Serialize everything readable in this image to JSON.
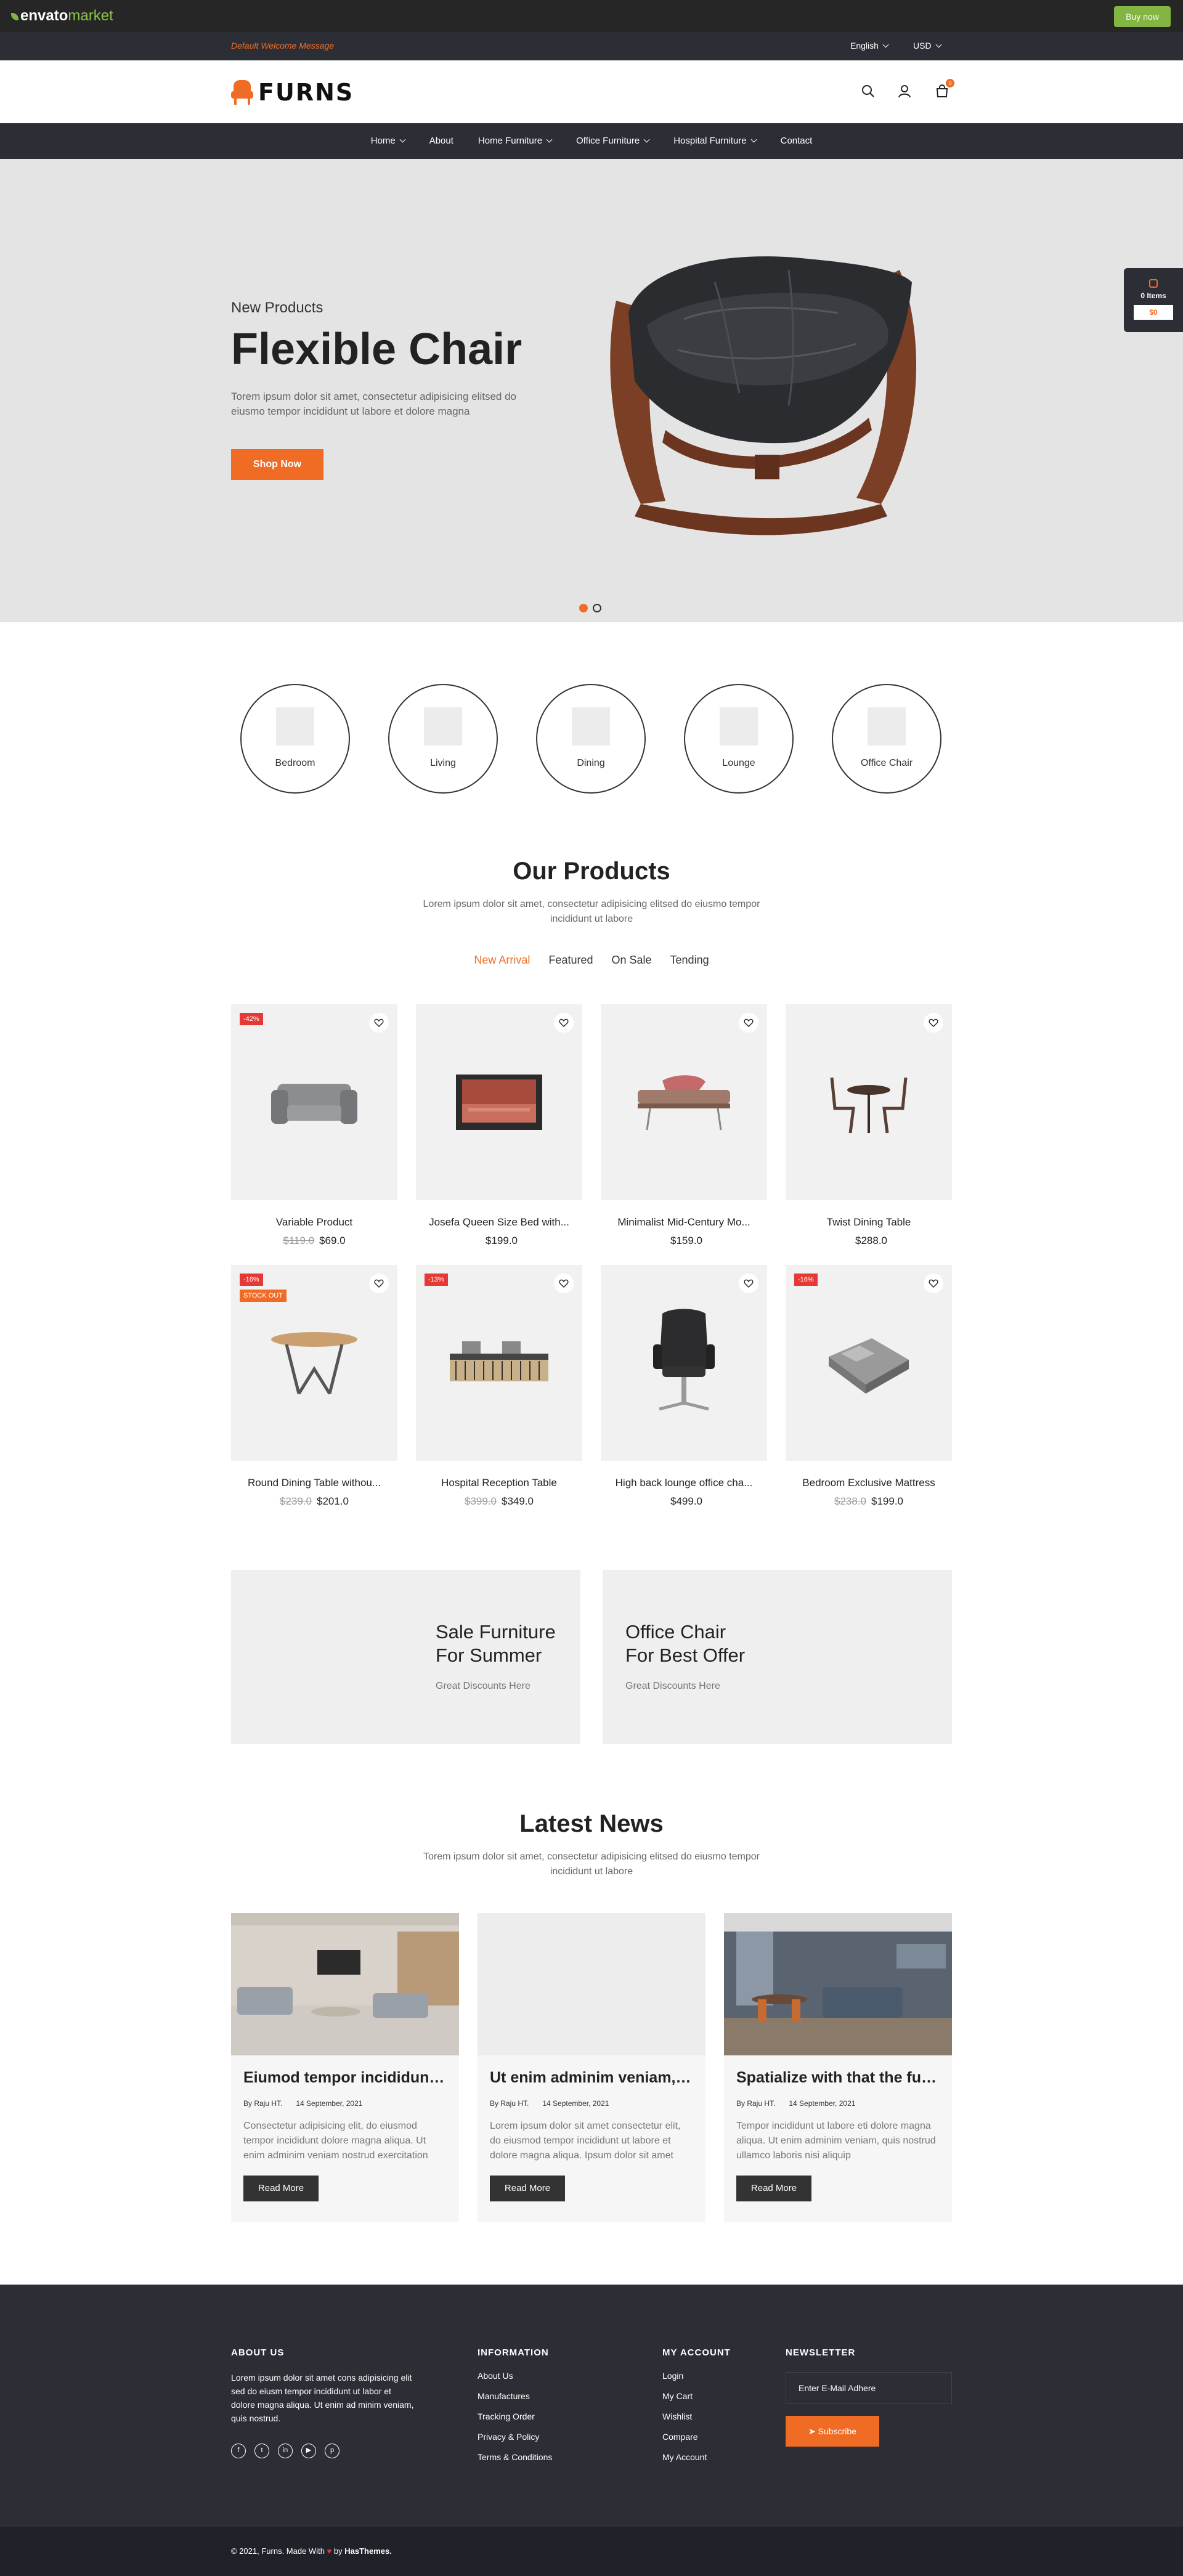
{
  "envato": {
    "logo": "envato",
    "logo_suffix": "market",
    "buy": "Buy now"
  },
  "topbar": {
    "welcome": "Default Welcome Message",
    "language": "English",
    "currency": "USD"
  },
  "header": {
    "brand": "FURNS",
    "cart_count": "0"
  },
  "nav": [
    "Home",
    "About",
    "Home Furniture",
    "Office Furniture",
    "Hospital Furniture",
    "Contact"
  ],
  "hero": {
    "subtitle": "New Products",
    "title": "Flexible Chair",
    "description": "Torem ipsum dolor sit amet, consectetur adipisicing elitsed do eiusmo tempor incididunt ut labore et dolore magna",
    "button": "Shop Now"
  },
  "side_cart": {
    "items": "0 Items",
    "amount": "$0"
  },
  "categories": [
    "Bedroom",
    "Living",
    "Dining",
    "Lounge",
    "Office Chair"
  ],
  "products_section": {
    "title": "Our Products",
    "description": "Lorem ipsum dolor sit amet, consectetur adipisicing elitsed do eiusmo tempor incididunt ut labore",
    "tabs": [
      "New Arrival",
      "Featured",
      "On Sale",
      "Tending"
    ]
  },
  "products": [
    {
      "name": "Variable Product",
      "old_price": "$119.0",
      "price": "$69.0",
      "badge": "-42%",
      "stock": ""
    },
    {
      "name": "Josefa Queen Size Bed with...",
      "old_price": "",
      "price": "$199.0",
      "badge": "",
      "stock": ""
    },
    {
      "name": "Minimalist Mid-Century Mo...",
      "old_price": "",
      "price": "$159.0",
      "badge": "",
      "stock": ""
    },
    {
      "name": "Twist Dining Table",
      "old_price": "",
      "price": "$288.0",
      "badge": "",
      "stock": ""
    },
    {
      "name": "Round Dining Table withou...",
      "old_price": "$239.0",
      "price": "$201.0",
      "badge": "-16%",
      "stock": "STOCK OUT"
    },
    {
      "name": "Hospital Reception Table",
      "old_price": "$399.0",
      "price": "$349.0",
      "badge": "-13%",
      "stock": ""
    },
    {
      "name": "High back lounge office cha...",
      "old_price": "",
      "price": "$499.0",
      "badge": "",
      "stock": ""
    },
    {
      "name": "Bedroom Exclusive Mattress",
      "old_price": "$238.0",
      "price": "$199.0",
      "badge": "-16%",
      "stock": ""
    }
  ],
  "banners": [
    {
      "title_line1": "Sale Furniture",
      "title_line2": "For Summer",
      "subtitle": "Great Discounts Here"
    },
    {
      "title_line1": "Office Chair",
      "title_line2": "For Best Offer",
      "subtitle": "Great Discounts Here"
    }
  ],
  "news_section": {
    "title": "Latest News",
    "description": "Torem ipsum dolor sit amet, consectetur adipisicing elitsed do eiusmo tempor incididunt ut labore"
  },
  "news": [
    {
      "title": "Eiumod tempor incididunt l...",
      "author": "By Raju HT.",
      "date": "14 September, 2021",
      "excerpt": "Consectetur adipisicing elit, do eiusmod tempor incididunt dolore magna aliqua. Ut enim adminim veniam nostrud exercitation",
      "button": "Read More"
    },
    {
      "title": "Ut enim adminim veniam, q...",
      "author": "By Raju HT.",
      "date": "14 September, 2021",
      "excerpt": "Lorem ipsum dolor sit amet consectetur elit, do eiusmod tempor incididunt ut labore et dolore magna aliqua. Ipsum dolor sit amet",
      "button": "Read More"
    },
    {
      "title": "Spatialize with that the furns",
      "author": "By Raju HT.",
      "date": "14 September, 2021",
      "excerpt": "Tempor incididunt ut labore eti dolore magna aliqua. Ut enim adminim veniam, quis nostrud ullamco laboris nisi aliquip",
      "button": "Read More"
    }
  ],
  "footer": {
    "about_title": "ABOUT US",
    "about_text": "Lorem ipsum dolor sit amet cons adipisicing elit sed do eiusm tempor incididunt ut labor et dolore magna aliqua. Ut enim ad minim veniam, quis nostrud.",
    "social_icons": [
      "facebook-icon",
      "twitter-icon",
      "linkedin-icon",
      "youtube-icon",
      "pinterest-icon"
    ],
    "info_title": "INFORMATION",
    "info_links": [
      "About Us",
      "Manufactures",
      "Tracking Order",
      "Privacy & Policy",
      "Terms & Conditions"
    ],
    "account_title": "MY ACCOUNT",
    "account_links": [
      "Login",
      "My Cart",
      "Wishlist",
      "Compare",
      "My Account"
    ],
    "newsletter_title": "NEWSLETTER",
    "newsletter_placeholder": "Enter E-Mail Adhere",
    "subscribe": "Subscribe"
  },
  "copyright": {
    "prefix": "© 2021, Furns. Made With",
    "by": "by",
    "company": "HasThemes."
  },
  "colors": {
    "accent": "#f06c24",
    "dark": "#2b2e35",
    "envato_green": "#82b541",
    "sale_red": "#e53935"
  }
}
